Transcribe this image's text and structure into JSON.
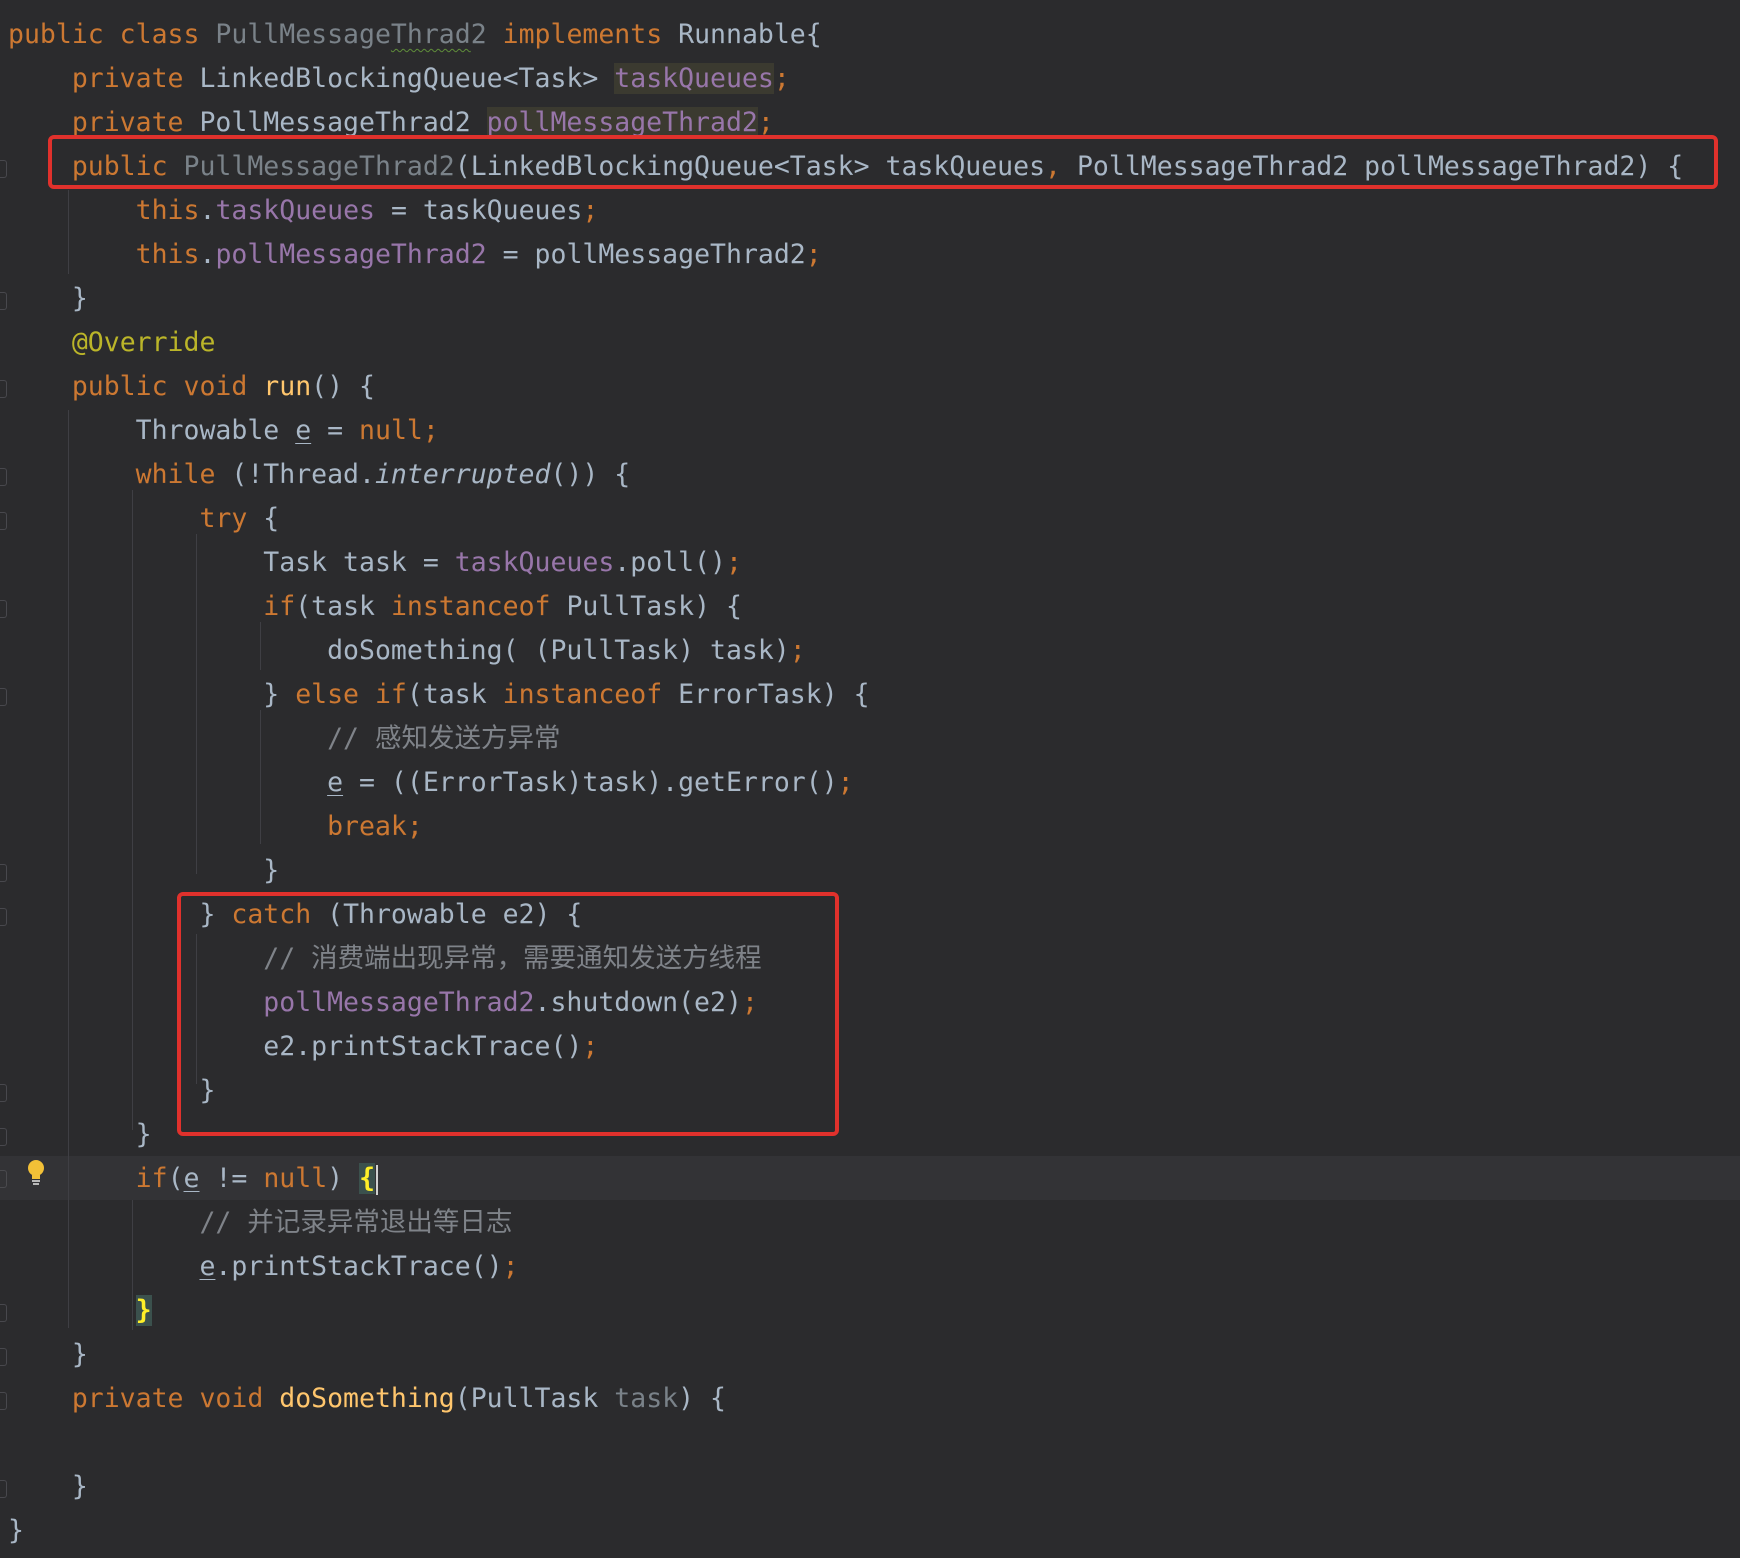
{
  "editor": {
    "language": "Java",
    "theme": "dark",
    "colors": {
      "background": "#2b2b2d",
      "highlight_box": "#e0312c",
      "keyword": "#cc7832",
      "field": "#9876aa",
      "method": "#ffc66d",
      "annotation": "#bbb529",
      "comment": "#7f8389"
    },
    "highlight_boxes": [
      "constructor-signature",
      "catch-block"
    ],
    "lines": [
      [
        {
          "t": "public class ",
          "c": "kw"
        },
        {
          "t": "PullMessage",
          "c": "dim"
        },
        {
          "t": "Thrad",
          "c": "dim squig"
        },
        {
          "t": "2 ",
          "c": "dim"
        },
        {
          "t": "implements ",
          "c": "kw"
        },
        {
          "t": "Runnable{",
          "c": "typ"
        }
      ],
      [
        {
          "t": "    private ",
          "c": "kw"
        },
        {
          "t": "LinkedBlockingQueue<Task> ",
          "c": "typ"
        },
        {
          "t": "taskQueues",
          "c": "fld fieldbg"
        },
        {
          "t": ";",
          "c": "kw"
        }
      ],
      [
        {
          "t": "    private ",
          "c": "kw"
        },
        {
          "t": "PollMessageThrad2 ",
          "c": "typ"
        },
        {
          "t": "pollMessageThrad2",
          "c": "fld fieldbg"
        },
        {
          "t": ";",
          "c": "kw"
        }
      ],
      [
        {
          "t": "    public ",
          "c": "kw"
        },
        {
          "t": "PullMessageThrad2",
          "c": "dim"
        },
        {
          "t": "(LinkedBlockingQueue<Task> taskQueues",
          "c": "typ"
        },
        {
          "t": ", ",
          "c": "kw"
        },
        {
          "t": "PollMessageThrad2 pollMessageThrad2) {",
          "c": "typ"
        }
      ],
      [
        {
          "t": "        ",
          "c": "typ"
        },
        {
          "t": "this",
          "c": "kw"
        },
        {
          "t": ".",
          "c": "typ"
        },
        {
          "t": "taskQueues",
          "c": "fld"
        },
        {
          "t": " = taskQueues",
          "c": "typ"
        },
        {
          "t": ";",
          "c": "kw"
        }
      ],
      [
        {
          "t": "        ",
          "c": "typ"
        },
        {
          "t": "this",
          "c": "kw"
        },
        {
          "t": ".",
          "c": "typ"
        },
        {
          "t": "pollMessageThrad2",
          "c": "fld"
        },
        {
          "t": " = pollMessageThrad2",
          "c": "typ"
        },
        {
          "t": ";",
          "c": "kw"
        }
      ],
      [
        {
          "t": "    }",
          "c": "typ"
        }
      ],
      [
        {
          "t": "    ",
          "c": "typ"
        },
        {
          "t": "@Override",
          "c": "ann"
        }
      ],
      [
        {
          "t": "    public void ",
          "c": "kw"
        },
        {
          "t": "run",
          "c": "fn"
        },
        {
          "t": "() {",
          "c": "typ"
        }
      ],
      [
        {
          "t": "        Throwable ",
          "c": "typ"
        },
        {
          "t": "e",
          "c": "typ under"
        },
        {
          "t": " = ",
          "c": "typ"
        },
        {
          "t": "null;",
          "c": "kw"
        }
      ],
      [
        {
          "t": "        ",
          "c": "typ"
        },
        {
          "t": "while ",
          "c": "kw"
        },
        {
          "t": "(!Thread.",
          "c": "typ"
        },
        {
          "t": "interrupted",
          "c": "typ ital"
        },
        {
          "t": "()) {",
          "c": "typ"
        }
      ],
      [
        {
          "t": "            ",
          "c": "typ"
        },
        {
          "t": "try ",
          "c": "kw"
        },
        {
          "t": "{",
          "c": "typ"
        }
      ],
      [
        {
          "t": "                Task task = ",
          "c": "typ"
        },
        {
          "t": "taskQueues",
          "c": "fld"
        },
        {
          "t": ".poll()",
          "c": "typ"
        },
        {
          "t": ";",
          "c": "kw"
        }
      ],
      [
        {
          "t": "                ",
          "c": "typ"
        },
        {
          "t": "if",
          "c": "kw"
        },
        {
          "t": "(task ",
          "c": "typ"
        },
        {
          "t": "instanceof ",
          "c": "kw"
        },
        {
          "t": "PullTask) {",
          "c": "typ"
        }
      ],
      [
        {
          "t": "                    doSomething( (PullTask) task)",
          "c": "typ"
        },
        {
          "t": ";",
          "c": "kw"
        }
      ],
      [
        {
          "t": "                } ",
          "c": "typ"
        },
        {
          "t": "else if",
          "c": "kw"
        },
        {
          "t": "(task ",
          "c": "typ"
        },
        {
          "t": "instanceof ",
          "c": "kw"
        },
        {
          "t": "ErrorTask) {",
          "c": "typ"
        }
      ],
      [
        {
          "t": "                    ",
          "c": "typ"
        },
        {
          "t": "// ",
          "c": "cmslash"
        },
        {
          "t": "感知发送方异常",
          "c": "cm"
        }
      ],
      [
        {
          "t": "                    ",
          "c": "typ"
        },
        {
          "t": "e",
          "c": "typ under"
        },
        {
          "t": " = ((ErrorTask)task).getError()",
          "c": "typ"
        },
        {
          "t": ";",
          "c": "kw"
        }
      ],
      [
        {
          "t": "                    ",
          "c": "typ"
        },
        {
          "t": "break;",
          "c": "kw"
        }
      ],
      [
        {
          "t": "                }",
          "c": "typ"
        }
      ],
      [
        {
          "t": "            } ",
          "c": "typ"
        },
        {
          "t": "catch ",
          "c": "kw"
        },
        {
          "t": "(Throwable e2) {",
          "c": "typ"
        }
      ],
      [
        {
          "t": "                ",
          "c": "typ"
        },
        {
          "t": "// ",
          "c": "cmslash"
        },
        {
          "t": "消费端出现异常，需要通知发送方线程",
          "c": "cm"
        }
      ],
      [
        {
          "t": "                ",
          "c": "typ"
        },
        {
          "t": "pollMessageThrad2",
          "c": "fld"
        },
        {
          "t": ".shutdown(e2)",
          "c": "typ"
        },
        {
          "t": ";",
          "c": "kw"
        }
      ],
      [
        {
          "t": "                e2.printStackTrace()",
          "c": "typ"
        },
        {
          "t": ";",
          "c": "kw"
        }
      ],
      [
        {
          "t": "            }",
          "c": "typ"
        }
      ],
      [
        {
          "t": "        }",
          "c": "typ"
        }
      ],
      [
        {
          "t": "        ",
          "c": "typ"
        },
        {
          "t": "if",
          "c": "kw"
        },
        {
          "t": "(",
          "c": "typ"
        },
        {
          "t": "e",
          "c": "typ under"
        },
        {
          "t": " != ",
          "c": "typ"
        },
        {
          "t": "null",
          "c": "kw"
        },
        {
          "t": ") ",
          "c": "typ"
        },
        {
          "t": "{",
          "c": "bracematch caret-after"
        }
      ],
      [
        {
          "t": "            ",
          "c": "typ"
        },
        {
          "t": "// ",
          "c": "cmslash"
        },
        {
          "t": "并记录异常退出等日志",
          "c": "cm"
        }
      ],
      [
        {
          "t": "            ",
          "c": "typ"
        },
        {
          "t": "e",
          "c": "typ under"
        },
        {
          "t": ".printStackTrace()",
          "c": "typ"
        },
        {
          "t": ";",
          "c": "kw"
        }
      ],
      [
        {
          "t": "        ",
          "c": "typ"
        },
        {
          "t": "}",
          "c": "bracematch"
        }
      ],
      [
        {
          "t": "    }",
          "c": "typ"
        }
      ],
      [
        {
          "t": "    private void ",
          "c": "kw"
        },
        {
          "t": "doSomething",
          "c": "fn"
        },
        {
          "t": "(PullTask ",
          "c": "typ"
        },
        {
          "t": "task",
          "c": "dim"
        },
        {
          "t": ") {",
          "c": "typ"
        }
      ],
      [
        {
          "t": "",
          "c": "typ"
        }
      ],
      [
        {
          "t": "    }",
          "c": "typ"
        }
      ],
      [
        {
          "t": "}",
          "c": "typ"
        }
      ]
    ]
  }
}
